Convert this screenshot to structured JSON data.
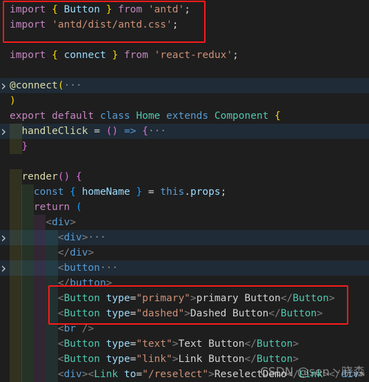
{
  "editor": {
    "colors": {
      "background": "#1e1e1e",
      "highlight_box": "#ff1a1a",
      "folded_line": "#1f2b36"
    },
    "lines": [
      {
        "indent": 0,
        "tokens": [
          [
            "import",
            "kw"
          ],
          [
            " ",
            "pun"
          ],
          [
            "{",
            "br1"
          ],
          [
            " Button ",
            "id"
          ],
          [
            "}",
            "br1"
          ],
          [
            " ",
            "pun"
          ],
          [
            "from",
            "kw"
          ],
          [
            " ",
            "pun"
          ],
          [
            "'antd'",
            "str"
          ],
          [
            ";",
            "pun"
          ]
        ]
      },
      {
        "indent": 0,
        "tokens": [
          [
            "import",
            "kw"
          ],
          [
            " ",
            "pun"
          ],
          [
            "'antd/dist/antd.css'",
            "str"
          ],
          [
            ";",
            "pun"
          ]
        ]
      },
      {
        "indent": 0,
        "tokens": []
      },
      {
        "indent": 0,
        "tokens": [
          [
            "import",
            "kw"
          ],
          [
            " ",
            "pun"
          ],
          [
            "{",
            "br1"
          ],
          [
            " connect ",
            "id"
          ],
          [
            "}",
            "br1"
          ],
          [
            " ",
            "pun"
          ],
          [
            "from",
            "kw"
          ],
          [
            " ",
            "pun"
          ],
          [
            "'react-redux'",
            "str"
          ],
          [
            ";",
            "pun"
          ]
        ]
      },
      {
        "indent": 0,
        "tokens": []
      },
      {
        "indent": 0,
        "folded": true,
        "tokens": [
          [
            "@connect",
            "dec"
          ],
          [
            "(",
            "br1"
          ],
          [
            "···",
            "dots"
          ]
        ]
      },
      {
        "indent": 0,
        "tokens": [
          [
            ")",
            "br1"
          ]
        ]
      },
      {
        "indent": 0,
        "tokens": [
          [
            "export",
            "kw"
          ],
          [
            " ",
            "pun"
          ],
          [
            "default",
            "kw"
          ],
          [
            " ",
            "pun"
          ],
          [
            "class",
            "blue"
          ],
          [
            " ",
            "pun"
          ],
          [
            "Home",
            "cls"
          ],
          [
            " ",
            "pun"
          ],
          [
            "extends",
            "blue"
          ],
          [
            " ",
            "pun"
          ],
          [
            "Component",
            "cls"
          ],
          [
            " ",
            "pun"
          ],
          [
            "{",
            "br1"
          ]
        ]
      },
      {
        "indent": 1,
        "folded": true,
        "tokens": [
          [
            "handleClick",
            "fn"
          ],
          [
            " = ",
            "pun"
          ],
          [
            "()",
            "br2"
          ],
          [
            " ",
            "pun"
          ],
          [
            "=>",
            "blue"
          ],
          [
            " ",
            "pun"
          ],
          [
            "{",
            "br2"
          ],
          [
            "···",
            "dots"
          ]
        ]
      },
      {
        "indent": 1,
        "tokens": [
          [
            "}",
            "br2"
          ]
        ]
      },
      {
        "indent": 0,
        "tokens": []
      },
      {
        "indent": 1,
        "tokens": [
          [
            "render",
            "fn"
          ],
          [
            "()",
            "br2"
          ],
          [
            " ",
            "pun"
          ],
          [
            "{",
            "br2"
          ]
        ]
      },
      {
        "indent": 2,
        "tokens": [
          [
            "const",
            "blue"
          ],
          [
            " ",
            "pun"
          ],
          [
            "{",
            "br3"
          ],
          [
            " homeName ",
            "id"
          ],
          [
            "}",
            "br3"
          ],
          [
            " = ",
            "pun"
          ],
          [
            "this",
            "blue"
          ],
          [
            ".",
            "pun"
          ],
          [
            "props",
            "id"
          ],
          [
            ";",
            "pun"
          ]
        ]
      },
      {
        "indent": 2,
        "tokens": [
          [
            "return",
            "kw"
          ],
          [
            " ",
            "pun"
          ],
          [
            "(",
            "br3"
          ]
        ]
      },
      {
        "indent": 3,
        "tokens": [
          [
            "<",
            "tag"
          ],
          [
            "div",
            "blue"
          ],
          [
            ">",
            "tag"
          ]
        ]
      },
      {
        "indent": 4,
        "folded": true,
        "tokens": [
          [
            "<",
            "tag"
          ],
          [
            "div",
            "blue"
          ],
          [
            ">",
            "tag"
          ],
          [
            "···",
            "dots"
          ]
        ]
      },
      {
        "indent": 4,
        "tokens": [
          [
            "</",
            "tag"
          ],
          [
            "div",
            "blue"
          ],
          [
            ">",
            "tag"
          ]
        ]
      },
      {
        "indent": 4,
        "folded": true,
        "tokens": [
          [
            "<",
            "tag"
          ],
          [
            "button",
            "blue"
          ],
          [
            "···",
            "dots"
          ]
        ]
      },
      {
        "indent": 4,
        "tokens": [
          [
            "</",
            "tag"
          ],
          [
            "button",
            "blue"
          ],
          [
            ">",
            "tag"
          ]
        ]
      },
      {
        "indent": 4,
        "tokens": [
          [
            "<",
            "tag"
          ],
          [
            "Button",
            "cls"
          ],
          [
            " ",
            "pun"
          ],
          [
            "type",
            "id"
          ],
          [
            "=",
            "pun"
          ],
          [
            "\"primary\"",
            "str"
          ],
          [
            ">",
            "tag"
          ],
          [
            "primary Button",
            "txt"
          ],
          [
            "</",
            "tag"
          ],
          [
            "Button",
            "cls"
          ],
          [
            ">",
            "tag"
          ]
        ]
      },
      {
        "indent": 4,
        "tokens": [
          [
            "<",
            "tag"
          ],
          [
            "Button",
            "cls"
          ],
          [
            " ",
            "pun"
          ],
          [
            "type",
            "id"
          ],
          [
            "=",
            "pun"
          ],
          [
            "\"dashed\"",
            "str"
          ],
          [
            ">",
            "tag"
          ],
          [
            "Dashed Button",
            "txt"
          ],
          [
            "</",
            "tag"
          ],
          [
            "Button",
            "cls"
          ],
          [
            ">",
            "tag"
          ]
        ]
      },
      {
        "indent": 4,
        "tokens": [
          [
            "<",
            "tag"
          ],
          [
            "br",
            "blue"
          ],
          [
            " />",
            "tag"
          ]
        ]
      },
      {
        "indent": 4,
        "tokens": [
          [
            "<",
            "tag"
          ],
          [
            "Button",
            "cls"
          ],
          [
            " ",
            "pun"
          ],
          [
            "type",
            "id"
          ],
          [
            "=",
            "pun"
          ],
          [
            "\"text\"",
            "str"
          ],
          [
            ">",
            "tag"
          ],
          [
            "Text Button",
            "txt"
          ],
          [
            "</",
            "tag"
          ],
          [
            "Button",
            "cls"
          ],
          [
            ">",
            "tag"
          ]
        ]
      },
      {
        "indent": 4,
        "tokens": [
          [
            "<",
            "tag"
          ],
          [
            "Button",
            "cls"
          ],
          [
            " ",
            "pun"
          ],
          [
            "type",
            "id"
          ],
          [
            "=",
            "pun"
          ],
          [
            "\"link\"",
            "str"
          ],
          [
            ">",
            "tag"
          ],
          [
            "Link Button",
            "txt"
          ],
          [
            "</",
            "tag"
          ],
          [
            "Button",
            "cls"
          ],
          [
            ">",
            "tag"
          ]
        ]
      },
      {
        "indent": 4,
        "tokens": [
          [
            "<",
            "tag"
          ],
          [
            "div",
            "blue"
          ],
          [
            ">",
            "tag"
          ],
          [
            "<",
            "tag"
          ],
          [
            "Link",
            "cls"
          ],
          [
            " ",
            "pun"
          ],
          [
            "to",
            "id"
          ],
          [
            "=",
            "pun"
          ],
          [
            "\"/reselect\"",
            "str"
          ],
          [
            ">",
            "tag"
          ],
          [
            "ReselectDemo",
            "txt"
          ],
          [
            "</",
            "tag"
          ],
          [
            "Link",
            "cls"
          ],
          [
            ">",
            "tag"
          ],
          [
            "</",
            "tag"
          ],
          [
            "div",
            "blue"
          ],
          [
            ">",
            "tag"
          ]
        ]
      }
    ]
  },
  "watermark": "CSDN @sen丶晓森"
}
